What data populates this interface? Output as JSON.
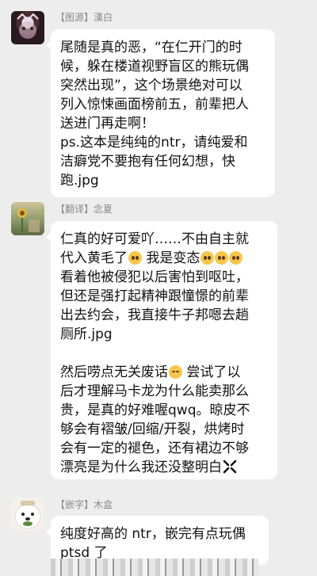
{
  "messages": [
    {
      "tag": "【图源】",
      "name": "漢白",
      "lines": [
        "尾随是真的恶，“在仁开门的时",
        "候，躲在楼道视野盲区的熊玩偶",
        "突然出现”，这个场景绝对可以",
        "列入惊悚画面榜前五，前辈把人",
        "送进门再走啊！",
        "ps.这本是纯纯的ntr，请纯爱和",
        "洁癖党不要抱有任何幻想，快",
        "跑.jpg"
      ]
    },
    {
      "tag": "【翻译】",
      "name": "念夏",
      "lines": [
        "仁真的好可爱吖……不由自主就",
        "代入黄毛了",
        "我是变态",
        "看着他被侵犯以后害怕到呕吐，",
        "但还是强打起精神跟憧憬的前辈",
        "出去约会，我直接牛子邦嗯去趟",
        "厕所.jpg",
        "然后唠点无关废话",
        "尝试了以",
        "后才理解马卡龙为什么能卖那么",
        "贵，是真的好难喔qwq。晾皮不",
        "够会有褶皱/回缩/开裂，烘烤时",
        "会有一定的褪色，还有裙边不够",
        "漂亮是为什么我还没整明白"
      ]
    },
    {
      "tag": "【嵌字】",
      "name": "木盒",
      "lines": [
        "纯度好高的 ntr，嵌完有点玩偶",
        "ptsd 了"
      ]
    }
  ],
  "icons": {
    "pleading_face": "pleading-face-icon",
    "neutral_face": "neutral-face-icon",
    "anger_symbol": "anger-symbol-icon"
  }
}
